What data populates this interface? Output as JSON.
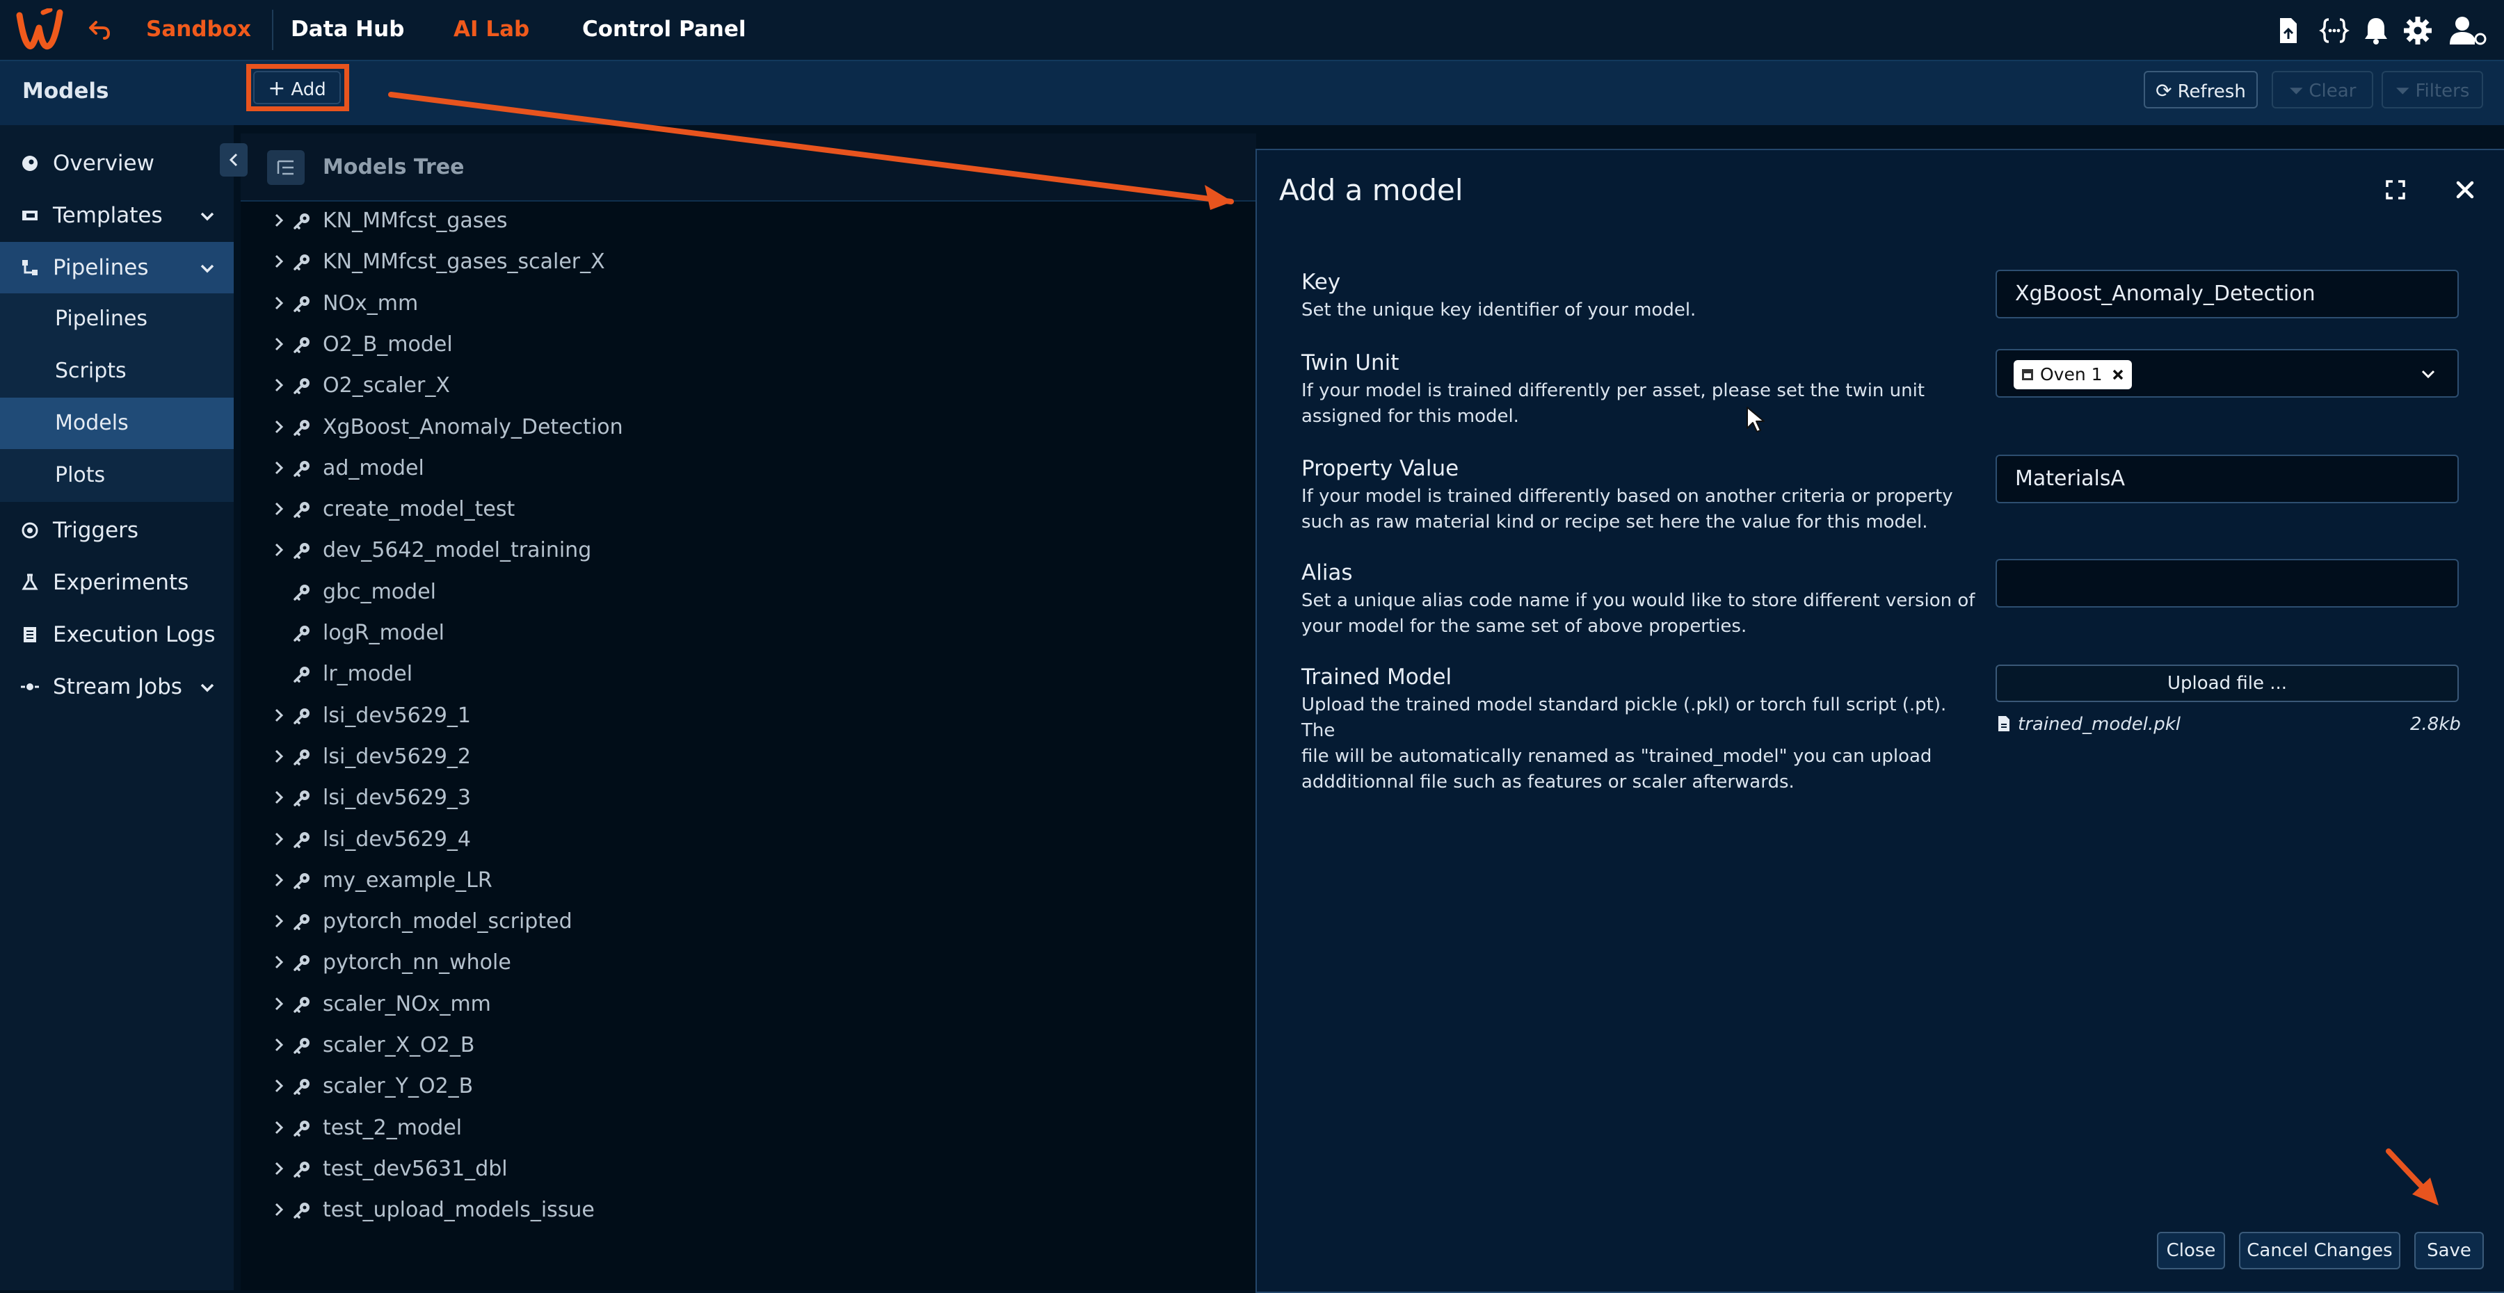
{
  "topbar": {
    "nav": [
      "Sandbox",
      "Data Hub",
      "AI Lab",
      "Control Panel"
    ],
    "brand_color": "#f05a1c",
    "icons": [
      "back-icon",
      "add-file-icon",
      "code-braces-icon",
      "bell-icon",
      "gear-icon",
      "user-settings-icon"
    ]
  },
  "subbar": {
    "page_title": "Models",
    "add_label": "Add",
    "refresh_label": "Refresh",
    "clear_label": "Clear",
    "filters_label": "Filters"
  },
  "sidebar": {
    "items": [
      {
        "label": "Overview",
        "icon": "rocket-icon"
      },
      {
        "label": "Templates",
        "icon": "template-icon"
      },
      {
        "label": "Pipelines",
        "icon": "pipeline-icon"
      },
      {
        "label": "Triggers",
        "icon": "trigger-icon"
      },
      {
        "label": "Experiments",
        "icon": "flask-icon"
      },
      {
        "label": "Execution Logs",
        "icon": "log-icon"
      },
      {
        "label": "Stream Jobs",
        "icon": "stream-icon"
      }
    ],
    "sub_items": [
      "Pipelines",
      "Scripts",
      "Models",
      "Plots"
    ],
    "active_sub": "Models"
  },
  "tree": {
    "title": "Models Tree",
    "items": [
      {
        "label": "KN_MMfcst_gases",
        "expandable": true
      },
      {
        "label": "KN_MMfcst_gases_scaler_X",
        "expandable": true
      },
      {
        "label": "NOx_mm",
        "expandable": true
      },
      {
        "label": "O2_B_model",
        "expandable": true
      },
      {
        "label": "O2_scaler_X",
        "expandable": true
      },
      {
        "label": "XgBoost_Anomaly_Detection",
        "expandable": true
      },
      {
        "label": "ad_model",
        "expandable": true
      },
      {
        "label": "create_model_test",
        "expandable": true
      },
      {
        "label": "dev_5642_model_training",
        "expandable": true
      },
      {
        "label": "gbc_model",
        "expandable": false
      },
      {
        "label": "logR_model",
        "expandable": false
      },
      {
        "label": "lr_model",
        "expandable": false
      },
      {
        "label": "lsi_dev5629_1",
        "expandable": true
      },
      {
        "label": "lsi_dev5629_2",
        "expandable": true
      },
      {
        "label": "lsi_dev5629_3",
        "expandable": true
      },
      {
        "label": "lsi_dev5629_4",
        "expandable": true
      },
      {
        "label": "my_example_LR",
        "expandable": true
      },
      {
        "label": "pytorch_model_scripted",
        "expandable": true
      },
      {
        "label": "pytorch_nn_whole",
        "expandable": true
      },
      {
        "label": "scaler_NOx_mm",
        "expandable": true
      },
      {
        "label": "scaler_X_O2_B",
        "expandable": true
      },
      {
        "label": "scaler_Y_O2_B",
        "expandable": true
      },
      {
        "label": "test_2_model",
        "expandable": true
      },
      {
        "label": "test_dev5631_dbl",
        "expandable": true
      },
      {
        "label": "test_upload_models_issue",
        "expandable": true
      }
    ]
  },
  "modal": {
    "title": "Add a model",
    "fields": {
      "key": {
        "label": "Key",
        "desc": [
          "Set the unique key identifier of your model."
        ],
        "value": "XgBoost_Anomaly_Detection"
      },
      "twin": {
        "label": "Twin Unit",
        "desc": [
          "If your model is trained differently per asset, please set the twin unit",
          "assigned for this model."
        ],
        "chip": "Oven 1"
      },
      "property": {
        "label": "Property Value",
        "desc": [
          "If your model is trained differently based on another criteria or property",
          "such as raw material kind or recipe set here the value for this model."
        ],
        "value": "MaterialsA"
      },
      "alias": {
        "label": "Alias",
        "desc": [
          "Set a unique alias code name if you would like to store different version of",
          "your model for the same set of above properties."
        ],
        "value": ""
      },
      "trained": {
        "label": "Trained Model",
        "desc": [
          "Upload the trained model standard pickle (.pkl) or torch full script (.pt). The",
          "file will be automatically renamed as \"trained_model\" you can upload",
          "addditionnal file such as features or scaler afterwards."
        ],
        "upload_label": "Upload file ...",
        "file_name": "trained_model.pkl",
        "file_size": "2.8kb"
      }
    },
    "buttons": {
      "close": "Close",
      "cancel": "Cancel Changes",
      "save": "Save"
    }
  },
  "annotation_color": "#e8541e"
}
